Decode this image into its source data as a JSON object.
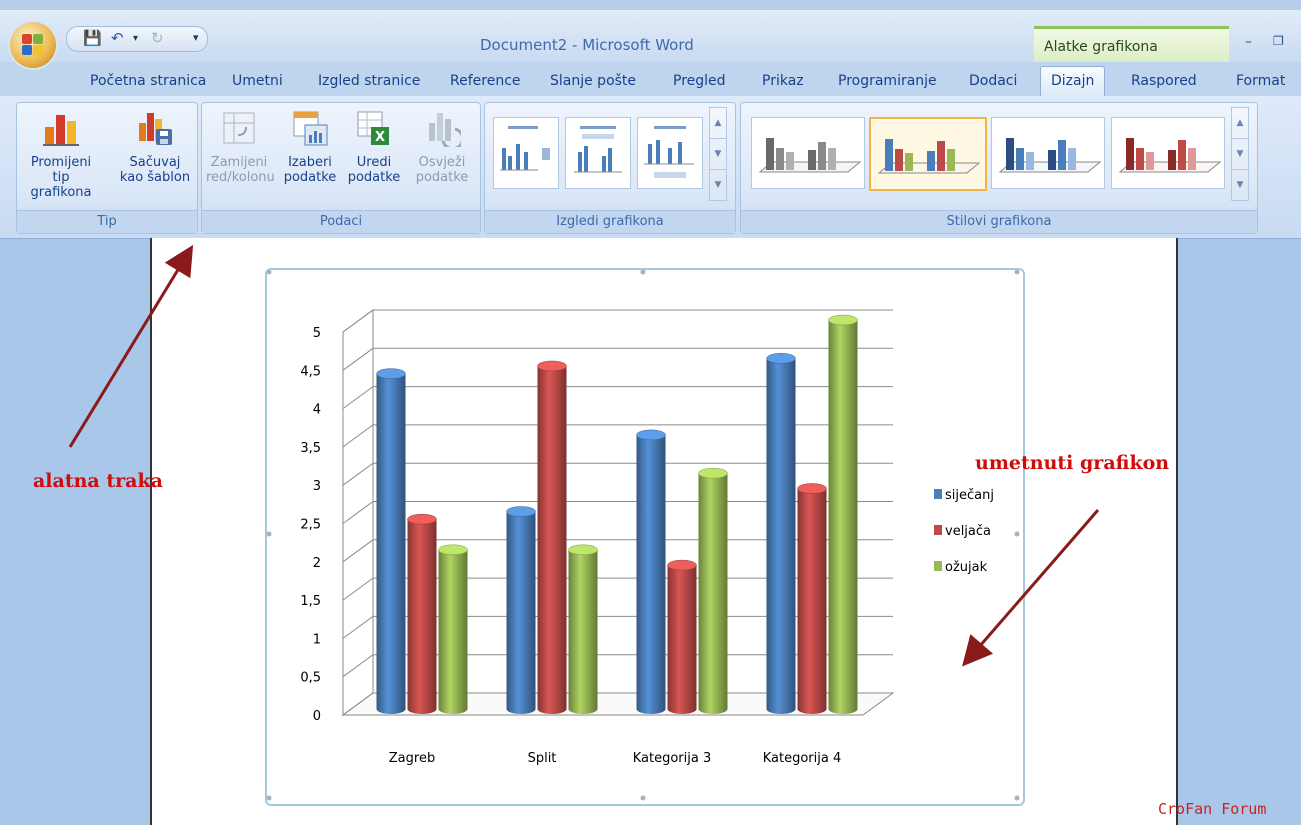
{
  "window": {
    "title": "Document2 - Microsoft Word",
    "context_tab_title": "Alatke grafikona"
  },
  "tabs": [
    {
      "label": "Početna stranica"
    },
    {
      "label": "Umetni"
    },
    {
      "label": "Izgled stranice"
    },
    {
      "label": "Reference"
    },
    {
      "label": "Slanje pošte"
    },
    {
      "label": "Pregled"
    },
    {
      "label": "Prikaz"
    },
    {
      "label": "Programiranje"
    },
    {
      "label": "Dodaci"
    },
    {
      "label": "Dizajn",
      "active": true
    },
    {
      "label": "Raspored"
    },
    {
      "label": "Format"
    }
  ],
  "ribbon": {
    "tip": {
      "label": "Tip",
      "buttons": [
        {
          "line1": "Promijeni tip",
          "line2": "grafikona",
          "icon": "change-chart-type-icon"
        },
        {
          "line1": "Sačuvaj",
          "line2": "kao šablon",
          "icon": "save-template-icon"
        }
      ]
    },
    "podaci": {
      "label": "Podaci",
      "buttons": [
        {
          "line1": "Zamijeni",
          "line2": "red/kolonu",
          "icon": "switch-row-column-icon",
          "disabled": true
        },
        {
          "line1": "Izaberi",
          "line2": "podatke",
          "icon": "select-data-icon"
        },
        {
          "line1": "Uredi",
          "line2": "podatke",
          "icon": "edit-data-icon"
        },
        {
          "line1": "Osvježi",
          "line2": "podatke",
          "icon": "refresh-data-icon",
          "disabled": true
        }
      ]
    },
    "izgledi": {
      "label": "Izgledi grafikona"
    },
    "stilovi": {
      "label": "Stilovi grafikona"
    }
  },
  "annotations": {
    "toolbar": "alatna traka",
    "chart": "umetnuti grafikon",
    "watermark": "CroFan Forum"
  },
  "colors": {
    "series1": "#4a7ebb",
    "series2": "#be4b48",
    "series3": "#98b954",
    "annotation": "#d10a0a"
  },
  "chart_data": {
    "type": "bar",
    "categories": [
      "Zagreb",
      "Split",
      "Kategorija 3",
      "Kategorija 4"
    ],
    "series": [
      {
        "name": "siječanj",
        "values": [
          4.3,
          2.5,
          3.5,
          4.5
        ]
      },
      {
        "name": "veljača",
        "values": [
          2.4,
          4.4,
          1.8,
          2.8
        ]
      },
      {
        "name": "ožujak",
        "values": [
          2,
          2,
          3,
          5
        ]
      }
    ],
    "yticks": [
      "0",
      "0,5",
      "1",
      "1,5",
      "2",
      "2,5",
      "3",
      "3,5",
      "4",
      "4,5",
      "5"
    ],
    "ylim": [
      0,
      5
    ],
    "grid": true,
    "legend": "right",
    "style": "3d-cylinder"
  }
}
